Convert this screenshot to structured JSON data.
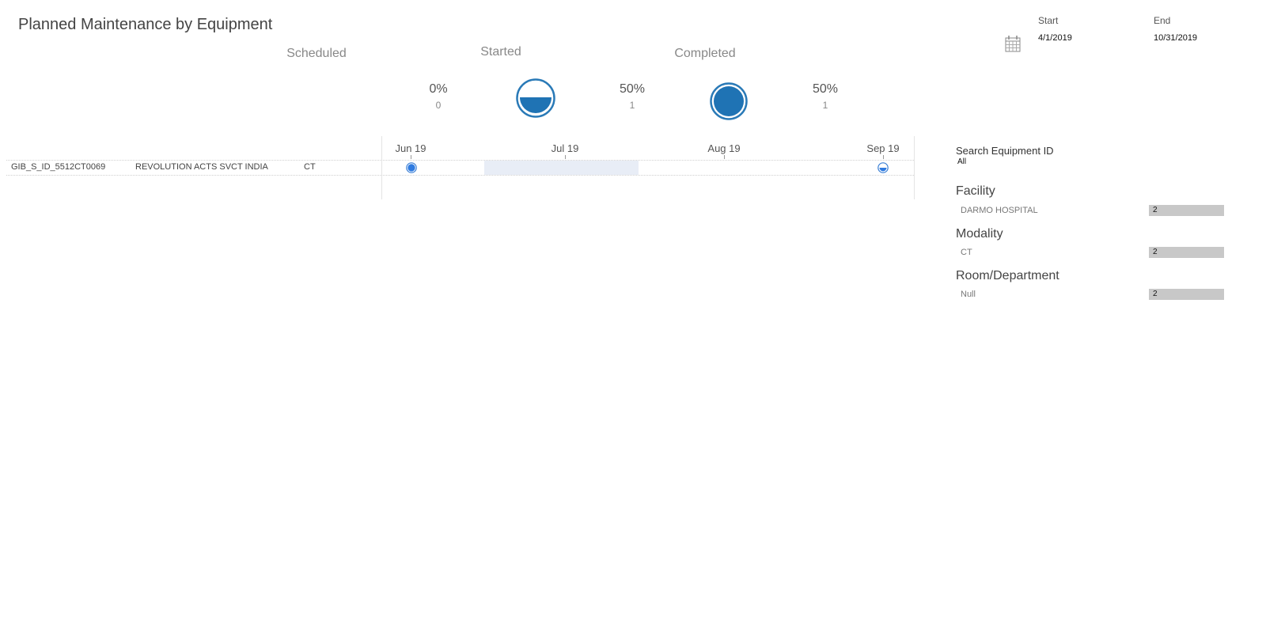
{
  "page_title": "Planned Maintenance by Equipment",
  "date_range": {
    "start_label": "Start",
    "start_value": "4/1/2019",
    "end_label": "End",
    "end_value": "10/31/2019",
    "icon": "calendar-icon"
  },
  "kpis": {
    "scheduled": {
      "label": "Scheduled",
      "percent": "0%",
      "count": "0"
    },
    "started": {
      "label": "Started",
      "percent": "50%",
      "count": "1",
      "icon": "half-filled-circle-icon"
    },
    "completed": {
      "label": "Completed",
      "percent": "50%",
      "count": "1",
      "icon": "filled-circle-icon"
    }
  },
  "gantt": {
    "months": [
      "Jun 19",
      "Jul 19",
      "Aug 19",
      "Sep 19"
    ],
    "rows": [
      {
        "equipment_id": "GIB_S_ID_5512CT0069",
        "description": "REVOLUTION ACTS SVCT INDIA",
        "modality": "CT"
      }
    ],
    "accent": "#1f77b4"
  },
  "filters": {
    "search_label": "Search Equipment ID",
    "search_value": "All",
    "facets": [
      {
        "title": "Facility",
        "item": "DARMO HOSPITAL",
        "count": "2"
      },
      {
        "title": "Modality",
        "item": "CT",
        "count": "2"
      },
      {
        "title": "Room/Department",
        "item": "Null",
        "count": "2"
      }
    ]
  }
}
